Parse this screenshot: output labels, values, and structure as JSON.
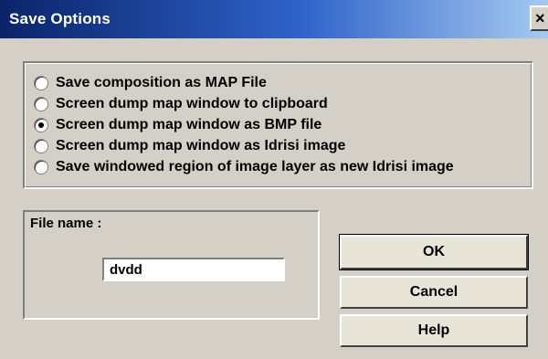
{
  "window": {
    "title": "Save Options",
    "close_label": "×"
  },
  "options": {
    "items": [
      {
        "label": "Save composition as MAP File",
        "checked": false
      },
      {
        "label": "Screen dump map window to clipboard",
        "checked": false
      },
      {
        "label": "Screen dump map window as BMP file",
        "checked": true
      },
      {
        "label": "Screen dump map window as Idrisi image",
        "checked": false
      },
      {
        "label": "Save windowed region of image layer as new Idrisi image",
        "checked": false
      }
    ]
  },
  "file": {
    "label": "File name :",
    "value": "dvdd"
  },
  "buttons": {
    "ok": "OK",
    "cancel": "Cancel",
    "help": "Help"
  }
}
